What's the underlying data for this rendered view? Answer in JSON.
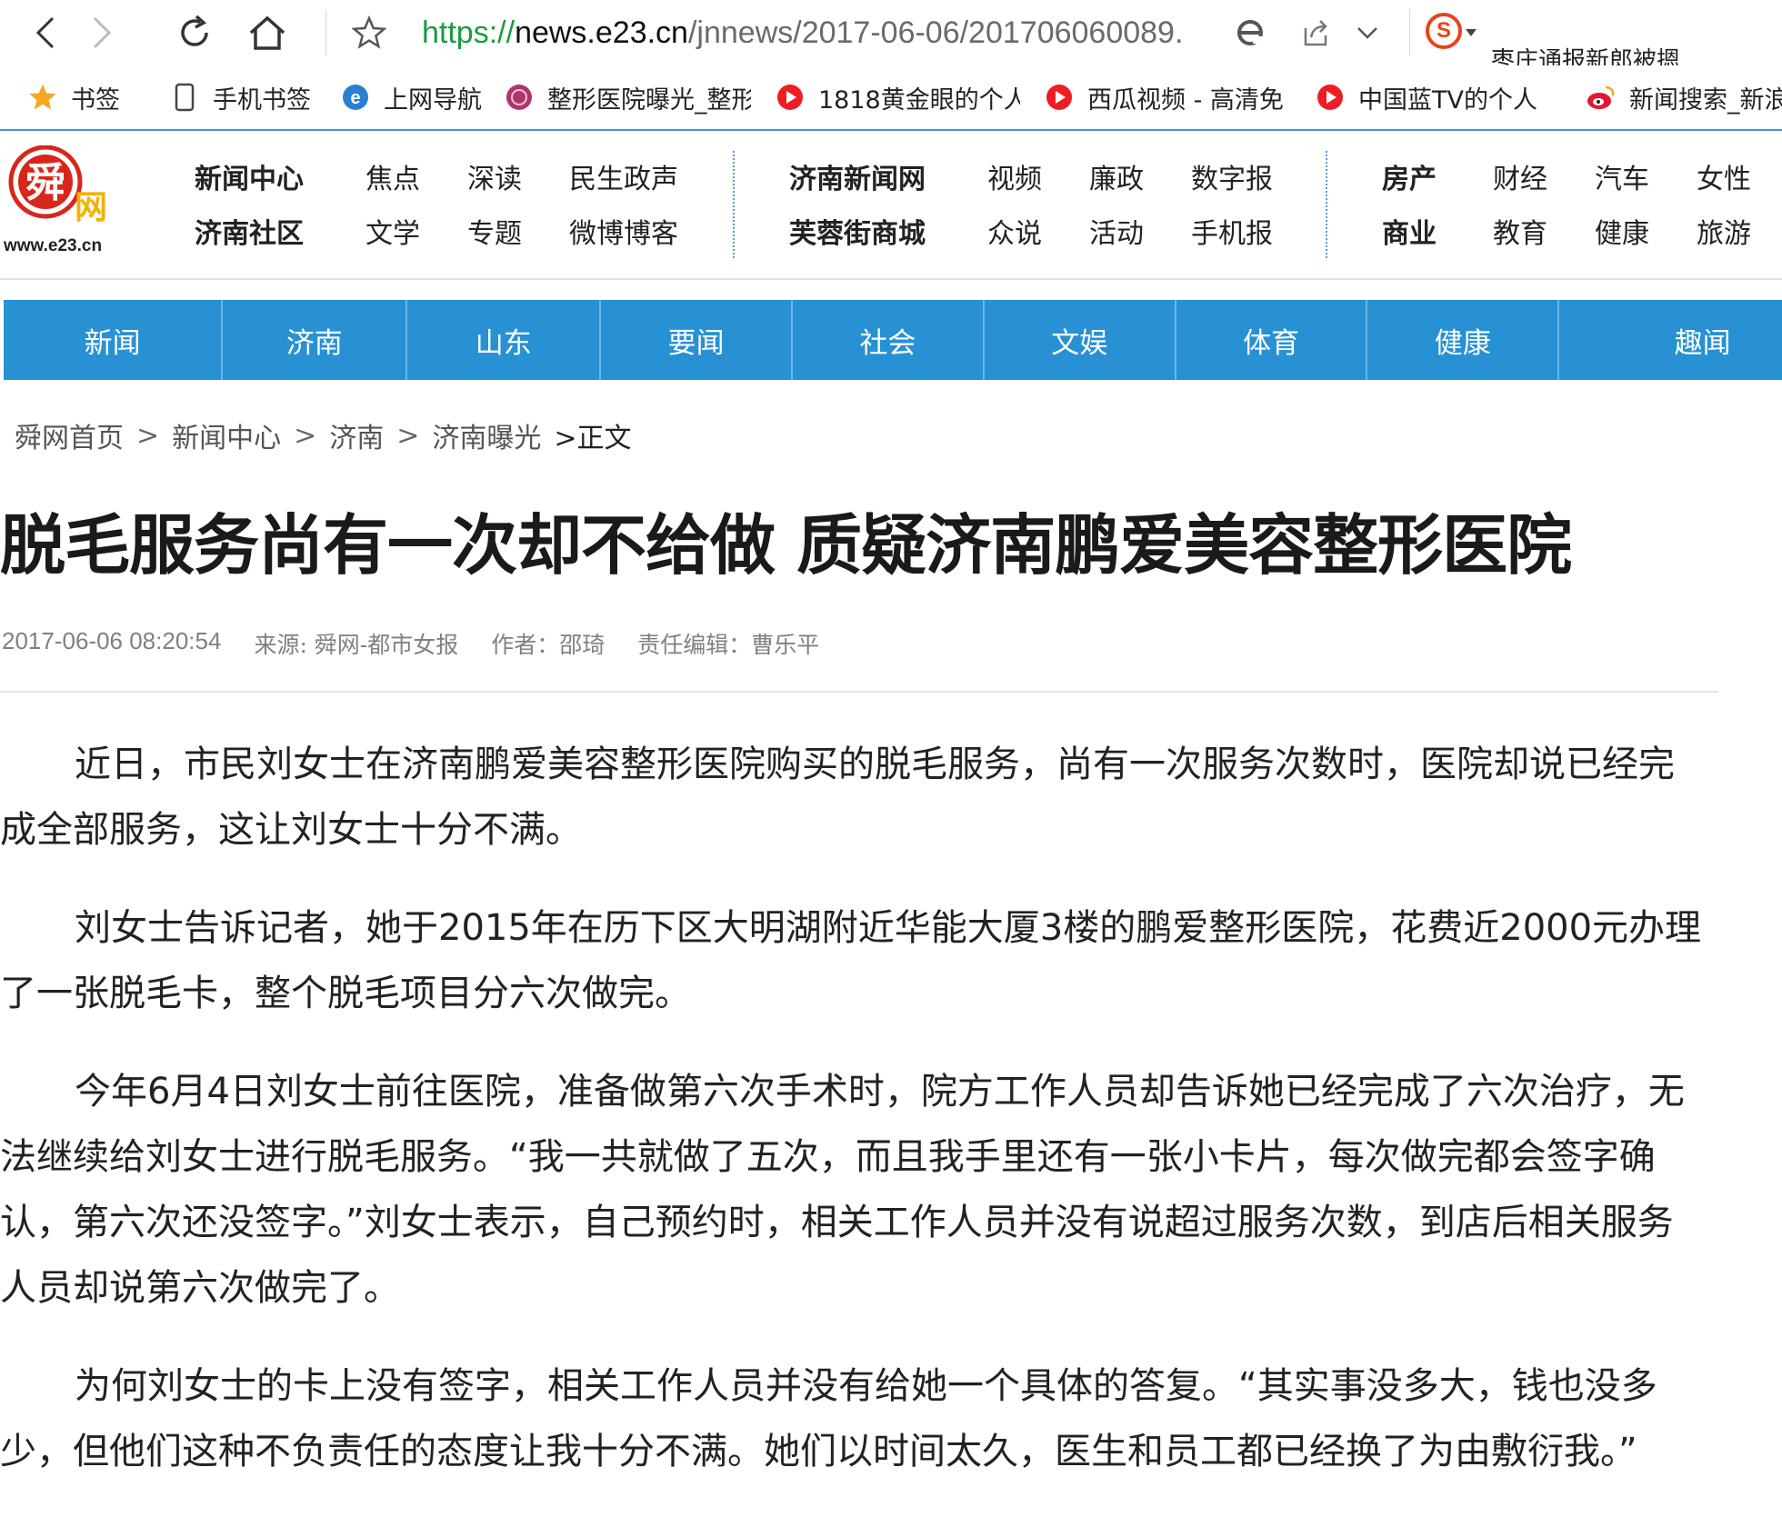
{
  "browser": {
    "url_scheme": "https://",
    "url_host": "news.e23.cn",
    "url_path": "/jnnews/2017-06-06/201706060089.",
    "clipped_text": "枣庄通报新郎被摁",
    "icons": [
      "back-icon",
      "forward-icon",
      "refresh-icon",
      "home-icon",
      "star-icon",
      "ie-mode-icon",
      "share-icon",
      "chevron-down-icon",
      "sogou-icon"
    ]
  },
  "bookmarks": [
    {
      "label": "书签",
      "icon": "star-icon"
    },
    {
      "label": "手机书签",
      "icon": "phone-icon"
    },
    {
      "label": "上网导航",
      "icon": "ie-icon"
    },
    {
      "label": "整形医院曝光_整形",
      "icon": "hospital-icon"
    },
    {
      "label": "1818黄金眼的个人",
      "icon": "video-icon"
    },
    {
      "label": "西瓜视频 - 高清免",
      "icon": "video-icon"
    },
    {
      "label": "中国蓝TV的个人主",
      "icon": "video-icon"
    },
    {
      "label": "新闻搜索_新浪",
      "icon": "weibo-icon"
    }
  ],
  "site": {
    "logo_domain": "www.e23.cn",
    "logo_mark": "舜",
    "logo_sub": "网",
    "header_groups": [
      {
        "rows": [
          [
            "新闻中心",
            "焦点",
            "深读",
            "民生政声"
          ],
          [
            "济南社区",
            "文学",
            "专题",
            "微博博客"
          ]
        ]
      },
      {
        "rows": [
          [
            "济南新闻网",
            "视频",
            "廉政",
            "数字报"
          ],
          [
            "芙蓉街商城",
            "众说",
            "活动",
            "手机报"
          ]
        ]
      },
      {
        "rows": [
          [
            "房产",
            "财经",
            "汽车",
            "女性"
          ],
          [
            "商业",
            "教育",
            "健康",
            "旅游"
          ]
        ]
      }
    ],
    "channels": [
      "新闻",
      "济南",
      "山东",
      "要闻",
      "社会",
      "文娱",
      "体育",
      "健康",
      "趣闻"
    ]
  },
  "breadcrumb": {
    "items": [
      "舜网首页",
      "新闻中心",
      "济南",
      "济南曝光"
    ],
    "separator": ">",
    "current": ">正文"
  },
  "article": {
    "title": "脱毛服务尚有一次却不给做 质疑济南鹏爱美容整形医院",
    "date": "2017-06-06 08:20:54",
    "source": "来源: 舜网-都市女报",
    "author": "作者：邵琦",
    "editor": "责任编辑：曹乐平",
    "paragraphs": [
      "近日，市民刘女士在济南鹏爱美容整形医院购买的脱毛服务，尚有一次服务次数时，医院却说已经完成全部服务，这让刘女士十分不满。",
      "刘女士告诉记者，她于2015年在历下区大明湖附近华能大厦3楼的鹏爱整形医院，花费近2000元办理了一张脱毛卡，整个脱毛项目分六次做完。",
      "今年6月4日刘女士前往医院，准备做第六次手术时，院方工作人员却告诉她已经完成了六次治疗，无法继续给刘女士进行脱毛服务。“我一共就做了五次，而且我手里还有一张小卡片，每次做完都会签字确认，第六次还没签字。”刘女士表示，自己预约时，相关工作人员并没有说超过服务次数，到店后相关服务人员却说第六次做完了。",
      "为何刘女士的卡上没有签字，相关工作人员并没有给她一个具体的答复。“其实事没多大，钱也没多少，但他们这种不负责任的态度让我十分不满。她们以时间太久，医生和员工都已经换了为由敷衍我。”"
    ]
  },
  "colors": {
    "url_scheme": "#1a9c3e",
    "channel_bar": "#2891d4",
    "logo_red": "#d9261c",
    "bookmark_rule": "#4a8fe0"
  }
}
